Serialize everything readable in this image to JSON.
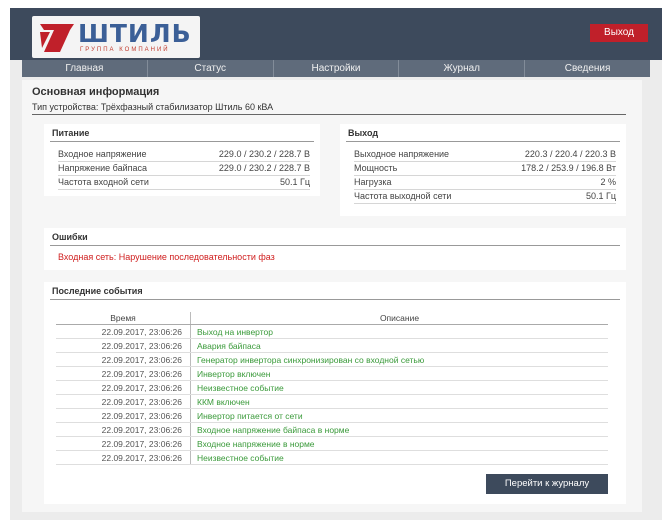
{
  "header": {
    "logo_text": "ШТИЛЬ",
    "logo_subtitle": "ГРУППА КОМПАНИЙ",
    "logo_icon": "shtil-logo-icon",
    "exit_label": "Выход",
    "accent_color": "#c0202a",
    "bar_color": "#3d4a5c"
  },
  "nav": {
    "items": [
      "Главная",
      "Статус",
      "Настройки",
      "Журнал",
      "Сведения"
    ]
  },
  "main": {
    "title": "Основная информация",
    "device_type": "Тип устройства: Трёхфазный стабилизатор Штиль 60 кВА"
  },
  "power": {
    "title": "Питание",
    "rows": [
      {
        "label": "Входное напряжение",
        "value": "229.0 / 230.2 / 228.7 В"
      },
      {
        "label": "Напряжение байпаса",
        "value": "229.0 / 230.2 / 228.7 В"
      },
      {
        "label": "Частота входной сети",
        "value": "50.1 Гц"
      }
    ]
  },
  "output": {
    "title": "Выход",
    "rows": [
      {
        "label": "Выходное напряжение",
        "value": "220.3 / 220.4 / 220.3 В"
      },
      {
        "label": "Мощность",
        "value": "178.2 / 253.9 / 196.8 Вт"
      },
      {
        "label": "Нагрузка",
        "value": "2 %"
      },
      {
        "label": "Частота выходной сети",
        "value": "50.1 Гц"
      }
    ]
  },
  "errors": {
    "title": "Ошибки",
    "message": "Входная сеть: Нарушение последовательности фаз",
    "color": "#d02020"
  },
  "events": {
    "title": "Последние события",
    "col_time": "Время",
    "col_desc": "Описание",
    "desc_color": "#3a9a3a",
    "rows": [
      {
        "time": "22.09.2017, 23:06:26",
        "desc": "Выход на инвертор"
      },
      {
        "time": "22.09.2017, 23:06:26",
        "desc": "Авария байпаса"
      },
      {
        "time": "22.09.2017, 23:06:26",
        "desc": "Генератор инвертора синхронизирован со входной сетью"
      },
      {
        "time": "22.09.2017, 23:06:26",
        "desc": "Инвертор включен"
      },
      {
        "time": "22.09.2017, 23:06:26",
        "desc": "Неизвестное событие"
      },
      {
        "time": "22.09.2017, 23:06:26",
        "desc": "ККМ включен"
      },
      {
        "time": "22.09.2017, 23:06:26",
        "desc": "Инвертор питается от сети"
      },
      {
        "time": "22.09.2017, 23:06:26",
        "desc": "Входное напряжение байпаса в норме"
      },
      {
        "time": "22.09.2017, 23:06:26",
        "desc": "Входное напряжение в норме"
      },
      {
        "time": "22.09.2017, 23:06:26",
        "desc": "Неизвестное событие"
      }
    ],
    "journal_button": "Перейти к журналу"
  }
}
